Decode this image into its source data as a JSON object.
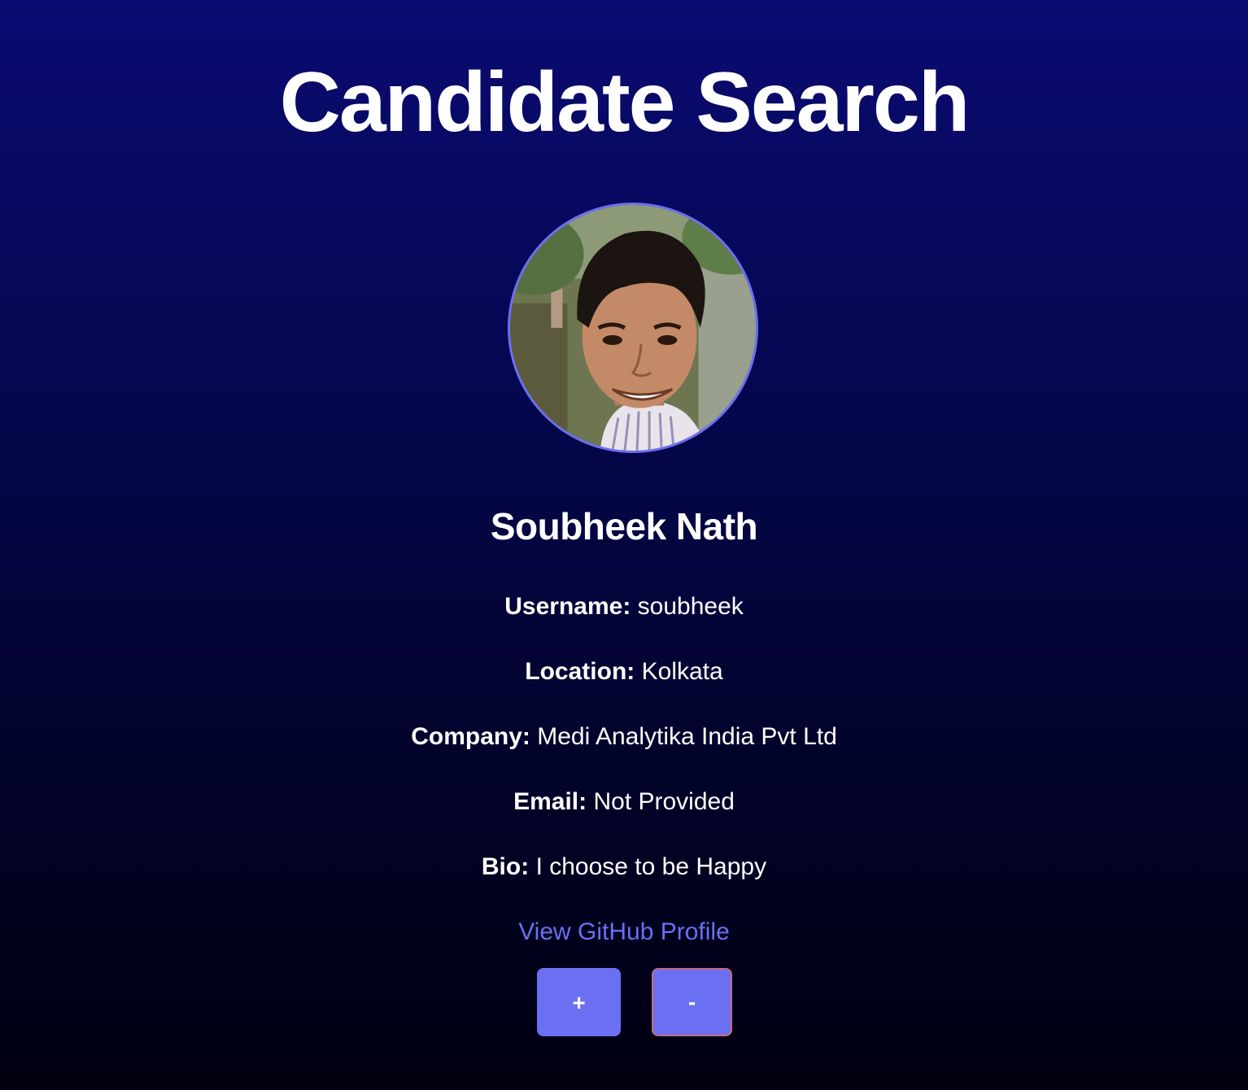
{
  "header": {
    "title": "Candidate Search"
  },
  "candidate": {
    "avatar": "candidate-avatar-photo",
    "name": "Soubheek Nath",
    "fields": {
      "username": {
        "label": "Username:",
        "value": "soubheek"
      },
      "location": {
        "label": "Location:",
        "value": "Kolkata"
      },
      "company": {
        "label": "Company:",
        "value": "Medi Analytika India Pvt Ltd"
      },
      "email": {
        "label": "Email:",
        "value": "Not Provided"
      },
      "bio": {
        "label": "Bio:",
        "value": "I choose to be Happy"
      }
    },
    "profile_link": "View GitHub Profile"
  },
  "actions": {
    "add_label": "+",
    "remove_label": "-"
  },
  "colors": {
    "accent": "#6b6ff2",
    "background_top": "#0a0b72",
    "background_bottom": "#000010",
    "remove_border": "#c06a80"
  }
}
